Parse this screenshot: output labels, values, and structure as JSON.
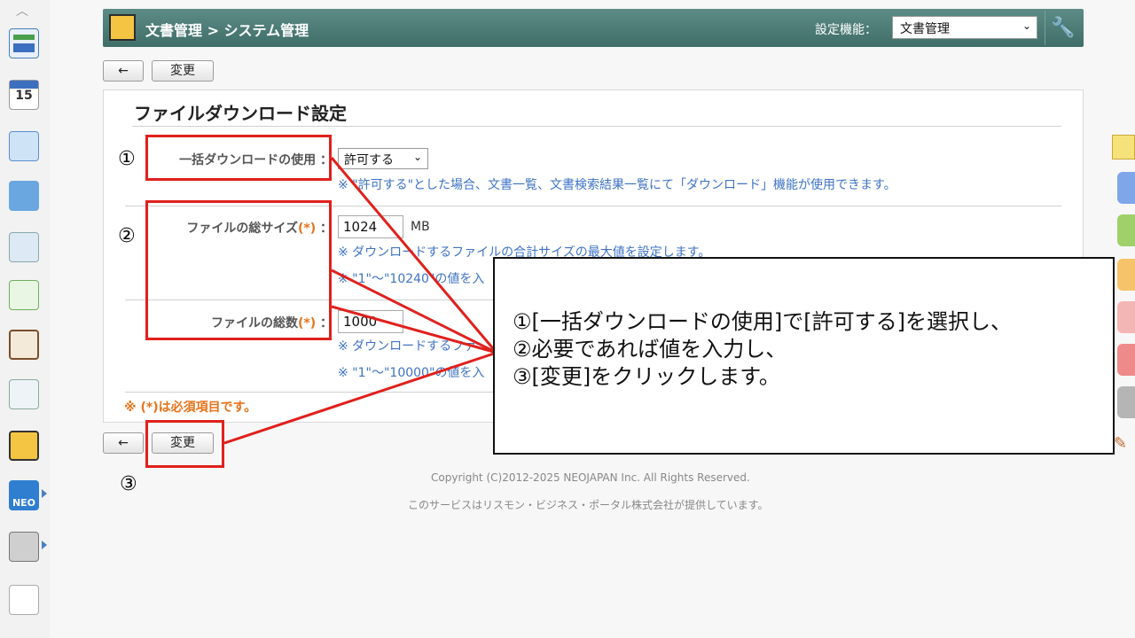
{
  "header": {
    "breadcrumb": "文書管理 > システム管理",
    "settings_label": "設定機能：",
    "settings_select_value": "文書管理"
  },
  "toolbar": {
    "back_icon": "←",
    "change_label": "変更"
  },
  "panel": {
    "title": "ファイルダウンロード設定",
    "bulk_download": {
      "label": "一括ダウンロードの使用 ：",
      "value": "許可する",
      "note": "※ \"許可する\"とした場合、文書一覧、文書検索結果一覧にて「ダウンロード」機能が使用できます。"
    },
    "total_size": {
      "label": "ファイルの総サイズ",
      "required": "(*)",
      "colon": "：",
      "value": "1024",
      "unit": "MB",
      "note1": "※ ダウンロードするファイルの合計サイズの最大値を設定します。",
      "note2": "※ \"1\"～\"10240\"の値を入"
    },
    "file_count": {
      "label": "ファイルの総数",
      "required": "(*)",
      "colon": "：",
      "value": "1000",
      "note1": "※ ダウンロードするファ",
      "note2": "※ \"1\"～\"10000\"の値を入"
    },
    "required_note": "※ (*)は必須項目です。"
  },
  "footer": {
    "copyright": "Copyright (C)2012-2025 NEOJAPAN Inc. All Rights Reserved.",
    "provider": "このサービスはリスモン・ビジネス・ポータル株式会社が提供しています。"
  },
  "annotations": {
    "marker1": "①",
    "marker2": "②",
    "marker3": "③",
    "callout_lines": [
      "①[一括ダウンロードの使用]で[許可する]を選択し、",
      "②必要であれば値を入力し、",
      "③[変更]をクリックします。"
    ]
  },
  "colors": {
    "header": "#4a7a75",
    "accent_red": "#e0201c",
    "note_blue": "#3f73c4",
    "required_orange": "#e6731a"
  },
  "icons": {
    "sidebar": [
      "collapse-up-icon",
      "dashboard-icon",
      "calendar-icon",
      "mail-icon",
      "database-icon",
      "report-icon",
      "sync-icon",
      "clipboard-icon",
      "board-icon",
      "document-binder-icon",
      "neo-icon",
      "folder-icon",
      "settings-list-icon"
    ],
    "calendar_day": "15",
    "neo_label": "NEO"
  }
}
